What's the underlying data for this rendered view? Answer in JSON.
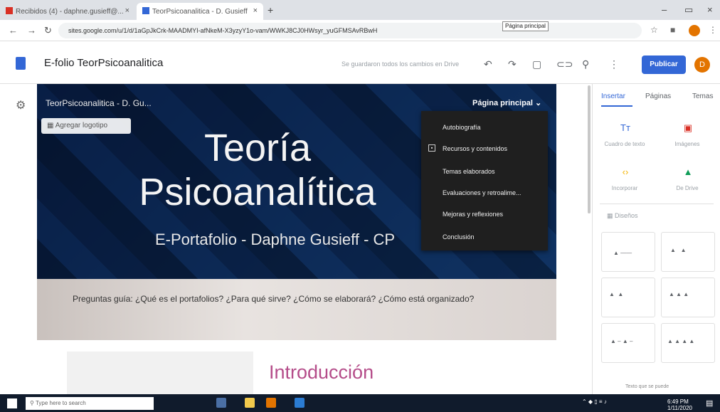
{
  "browser": {
    "tab1_label": "Recibidos (4) - daphne.gusieff@...",
    "tab2_label": "TeorPsicoanalitica - D. Gusieff",
    "url": "sites.google.com/u/1/d/1aGpJkCrk-MAADMYI-afNkeM-X3yzyY1o-vam/WWKJ8CJ0HWsyr_yuGFMSAvRBwH"
  },
  "app": {
    "doc_title": "E-folio TeorPsicoanalitica",
    "saved_status": "Se guardaron todos los cambios en Drive",
    "publish_label": "Publicar",
    "avatar_initial": "D"
  },
  "site": {
    "site_name": "TeorPsicoanalitica - D. Gu...",
    "page_menu_label": "Página principal",
    "logo_button_label": "Agregar logotipo",
    "title_line1": "Teoría",
    "title_line2": "Psicoanalítica",
    "subtitle": "E-Portafolio - Daphne Gusieff - CP",
    "tooltip": "Página principal",
    "question": "Preguntas guía: ¿Qué es el portafolios? ¿Para qué sirve? ¿Cómo se elaborará? ¿Cómo está organizado?",
    "section_title": "Introducción"
  },
  "dropdown": {
    "items": [
      "Autobiografía",
      "Recursos y contenidos",
      "Temas elaborados",
      "Evaluaciones y retroalime...",
      "Mejoras y reflexiones",
      "Conclusión"
    ]
  },
  "panel": {
    "tabs": [
      "Insertar",
      "Páginas",
      "Temas"
    ],
    "insert_items": [
      "Cuadro de texto",
      "Imágenes",
      "Incorporar",
      "De Drive"
    ],
    "layouts_label": "Diseños",
    "textbox_hint": "Texto que se puede"
  },
  "taskbar": {
    "search_placeholder": "Type here to search",
    "time": "6:49 PM",
    "date": "1/11/2020"
  },
  "colors": {
    "accent": "#3367d6",
    "section_title": "#b54d8a",
    "taskbar": "#101b2c"
  }
}
